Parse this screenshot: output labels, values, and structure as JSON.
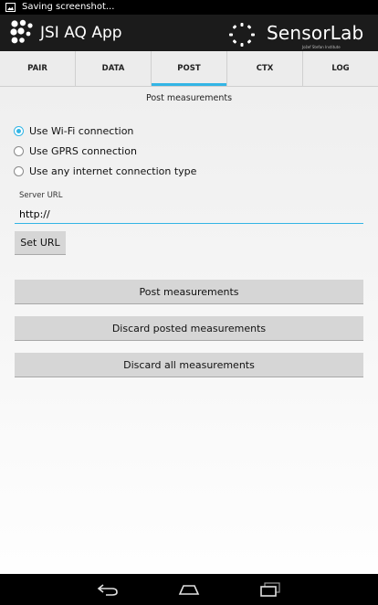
{
  "status_bar": {
    "text": "Saving screenshot..."
  },
  "app": {
    "title": "JSI AQ App"
  },
  "brand": {
    "name": "SensorLab",
    "subtitle": "Jožef Stefan Institute"
  },
  "tabs": [
    {
      "label": "PAIR"
    },
    {
      "label": "DATA"
    },
    {
      "label": "POST",
      "active": true
    },
    {
      "label": "CTX"
    },
    {
      "label": "LOG"
    }
  ],
  "page": {
    "title": "Post measurements"
  },
  "connection_options": [
    {
      "label": "Use Wi-Fi connection",
      "checked": true
    },
    {
      "label": "Use GPRS connection",
      "checked": false
    },
    {
      "label": "Use any internet connection type",
      "checked": false
    }
  ],
  "server": {
    "label": "Server URL",
    "value": "http://"
  },
  "buttons": {
    "set_url": "Set URL",
    "post": "Post measurements",
    "discard_posted": "Discard posted measurements",
    "discard_all": "Discard all measurements"
  },
  "colors": {
    "accent": "#33b5e5",
    "action_bar": "#1b1b1b",
    "button": "#d6d6d6"
  },
  "icons": [
    "screenshot-icon",
    "app-logo-icon",
    "sensorlab-logo-icon",
    "back-icon",
    "home-icon",
    "recents-icon"
  ]
}
